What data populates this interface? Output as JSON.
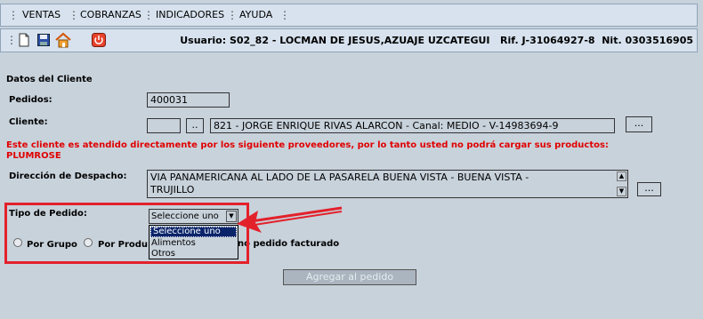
{
  "menu": {
    "items": [
      {
        "label": "VENTAS"
      },
      {
        "label": "COBRANZAS"
      },
      {
        "label": "INDICADORES"
      },
      {
        "label": "AYUDA"
      }
    ],
    "separator": "⋮"
  },
  "toolbar": {
    "user_info": "Usuario: S02_82 - LOCMAN DE JESUS,AZUAJE UZCATEGUI   Rif. J-31064927-8  Nit. 0303516905",
    "icons": [
      "new-document-icon",
      "save-icon",
      "home-icon",
      "power-icon"
    ]
  },
  "section_title": "Datos del Cliente",
  "pedidos": {
    "label": "Pedidos:",
    "value": "400031"
  },
  "cliente": {
    "label": "Cliente:",
    "code_value": "",
    "lookup_label": "..",
    "description": "821 - JORGE ENRIQUE RIVAS ALARCON -  Canal: MEDIO - V-14983694-9",
    "more_label": "..."
  },
  "warning": {
    "line1": "Este cliente es atendido directamente por los siguiente proveedores, por lo tanto usted no podrá cargar sus productos:",
    "line2": "PLUMROSE"
  },
  "despacho": {
    "label": "Dirección de Despacho:",
    "line1": "VIA PANAMERICANA AL LADO DE LA PASARELA           BUENA VISTA - BUENA VISTA -",
    "line2": "TRUJILLO",
    "more_label": "..."
  },
  "tipo_pedido": {
    "label": "Tipo de Pedido:",
    "selected": "Seleccione uno",
    "options": [
      "Seleccione uno",
      "Alimentos",
      "Otros"
    ]
  },
  "radios": {
    "por_grupo": "Por Grupo",
    "por_producto": "Por Produ",
    "ultimo": "no pedido facturado"
  },
  "add_button": "Agregar al pedido",
  "colors": {
    "annotation": "#e3212b",
    "warning": "#e00000",
    "selection": "#0a246a"
  }
}
